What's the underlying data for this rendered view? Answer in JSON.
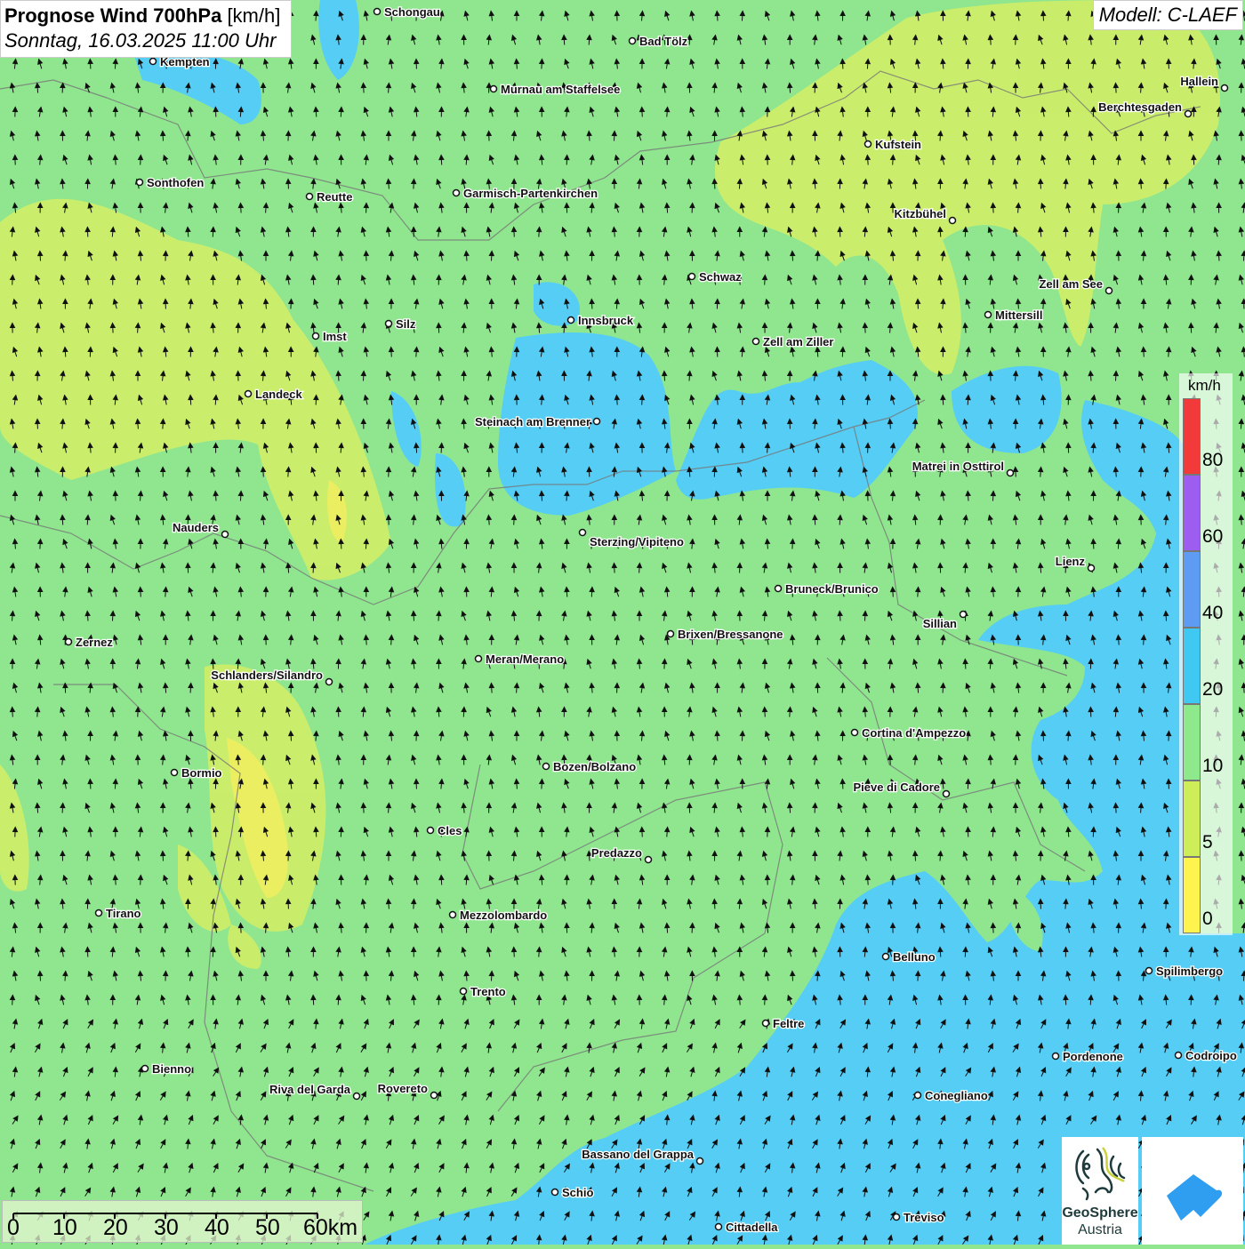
{
  "header": {
    "title_bold": "Prognose Wind 700hPa",
    "title_unit": "[km/h]",
    "datetime": "Sonntag, 16.03.2025 11:00 Uhr",
    "model": "Modell: C-LAEF"
  },
  "legend": {
    "unit": "km/h",
    "bins": [
      {
        "label": "80",
        "color": "#f23a3a"
      },
      {
        "label": "60",
        "color": "#9c5df0"
      },
      {
        "label": "40",
        "color": "#5d9cf2"
      },
      {
        "label": "20",
        "color": "#3ec8f2"
      },
      {
        "label": "10",
        "color": "#8ee88c"
      },
      {
        "label": "5",
        "color": "#cdee58"
      },
      {
        "label": "0",
        "color": "#fff44e"
      }
    ]
  },
  "scale_bar": {
    "labels": [
      "0",
      "10",
      "20",
      "30",
      "40",
      "50",
      "60km"
    ]
  },
  "logos": {
    "geosphere_line1": "GeoSphere",
    "geosphere_line2": "Austria"
  },
  "colors": {
    "base": "#8fe68f",
    "strong": "#55cdf5",
    "weak": "#cdee6a",
    "weakest": "#f2ee5e"
  },
  "cities": [
    "Schongau",
    "Bad Tölz",
    "Kempten",
    "Murnau am Staffelsee",
    "Hallein",
    "Berchtesgaden",
    "Kufstein",
    "Sonthofen",
    "Reutte",
    "Garmisch-Partenkirchen",
    "Kitzbühel",
    "Schwaz",
    "Zell am See",
    "Mittersill",
    "Innsbruck",
    "Silz",
    "Imst",
    "Zell am Ziller",
    "Landeck",
    "Steinach am Brenner",
    "Matrei in Osttirol",
    "Nauders",
    "Sterzing/Vipiteno",
    "Lienz",
    "Bruneck/Brunico",
    "Sillian",
    "Brixen/Bressanone",
    "Zernez",
    "Meran/Merano",
    "Schlanders/Silandro",
    "Cortina d'Ampezzo",
    "Bozen/Bolzano",
    "Bormio",
    "Pieve di Cadore",
    "Cles",
    "Predazzo",
    "Tirano",
    "Mezzolombardo",
    "Belluno",
    "Spilimbergo",
    "Trento",
    "Feltre",
    "Pordenone",
    "Codroipo",
    "Bienno",
    "Riva del Garda",
    "Rovereto",
    "Conegliano",
    "Bassano del Grappa",
    "Schio",
    "Treviso",
    "Cittadella"
  ]
}
